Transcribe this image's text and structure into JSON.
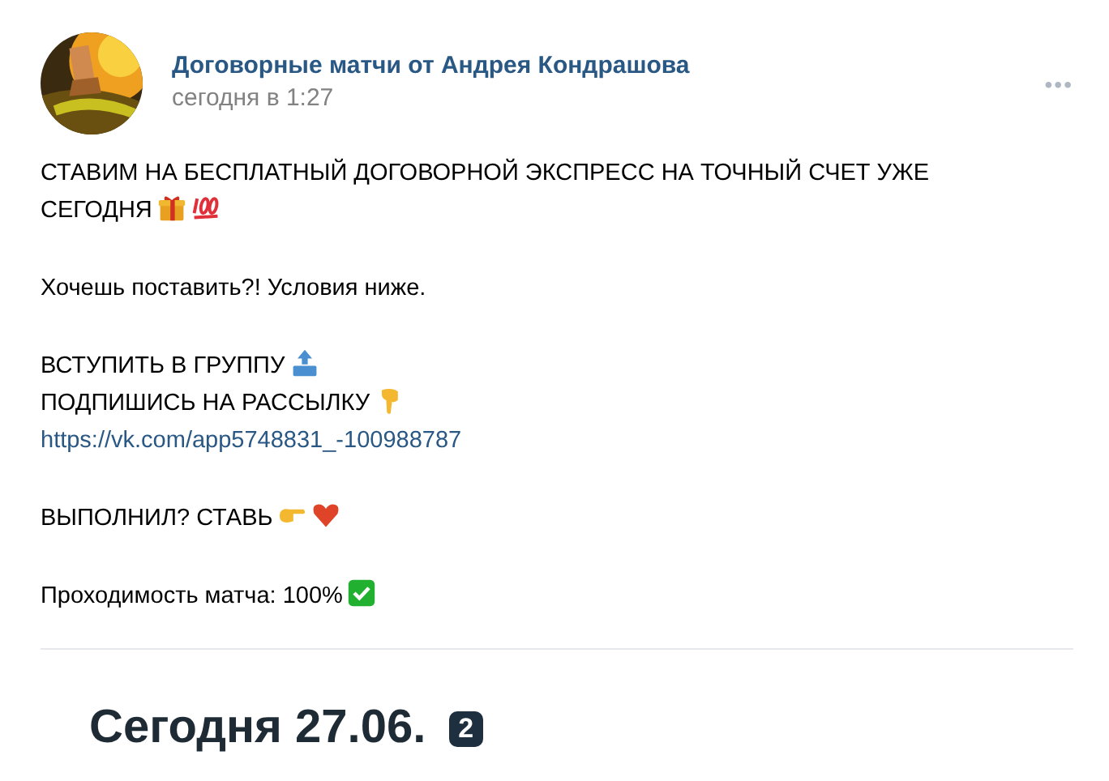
{
  "post": {
    "author": "Договорные матчи от Андрея Кондрашова",
    "time": "сегодня в 1:27",
    "menu": "•••",
    "blocks": [
      [
        [
          {
            "kind": "text",
            "text": "СТАВИМ НА БЕСПЛАТНЫЙ ДОГОВОРНОЙ ЭКСПРЕСС НА ТОЧНЫЙ СЧЕТ УЖЕ"
          }
        ],
        [
          {
            "kind": "text",
            "text": "СЕГОДНЯ"
          },
          {
            "kind": "gift"
          },
          {
            "kind": "hundred"
          }
        ]
      ],
      [
        [
          {
            "kind": "text",
            "text": "Хочешь поставить?! Условия ниже."
          }
        ]
      ],
      [
        [
          {
            "kind": "text",
            "text": "ВСТУПИТЬ В ГРУППУ"
          },
          {
            "kind": "top"
          }
        ],
        [
          {
            "kind": "text",
            "text": "ПОДПИШИСЬ НА РАССЫЛКУ"
          },
          {
            "kind": "point-down"
          }
        ],
        [
          {
            "kind": "link",
            "text": "https://vk.com/app5748831_-100988787"
          }
        ]
      ],
      [
        [
          {
            "kind": "text",
            "text": "ВЫПОЛНИЛ? СТАВЬ"
          },
          {
            "kind": "point-right"
          },
          {
            "kind": "heart"
          }
        ]
      ],
      [
        [
          {
            "kind": "text",
            "text": "Проходимость матча: 100%"
          },
          {
            "kind": "check"
          }
        ]
      ]
    ]
  },
  "attachment": {
    "heading": "Сегодня 27.06.",
    "badge": "2"
  }
}
